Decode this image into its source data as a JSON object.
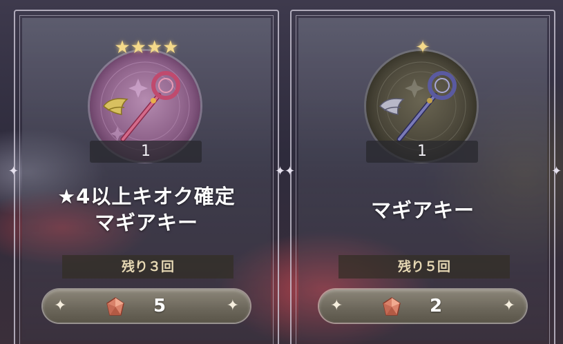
{
  "cards": [
    {
      "stars": "★★★★",
      "quantity": "1",
      "title_line1": "★4以上キオク確定",
      "title_line2": "マギアキー",
      "remaining": "残り３回",
      "price": "5",
      "badge_icon": "magia-key-pink-icon",
      "currency_icon": "gem-icon"
    },
    {
      "stars": "✦",
      "quantity": "1",
      "title_line1": "マギアキー",
      "remaining": "残り５回",
      "price": "2",
      "badge_icon": "magia-key-blue-icon",
      "currency_icon": "gem-icon"
    }
  ],
  "colors": {
    "star_gold": "#f4d98a",
    "remaining_text": "#e6d8b4",
    "gem": "#d9826a"
  }
}
